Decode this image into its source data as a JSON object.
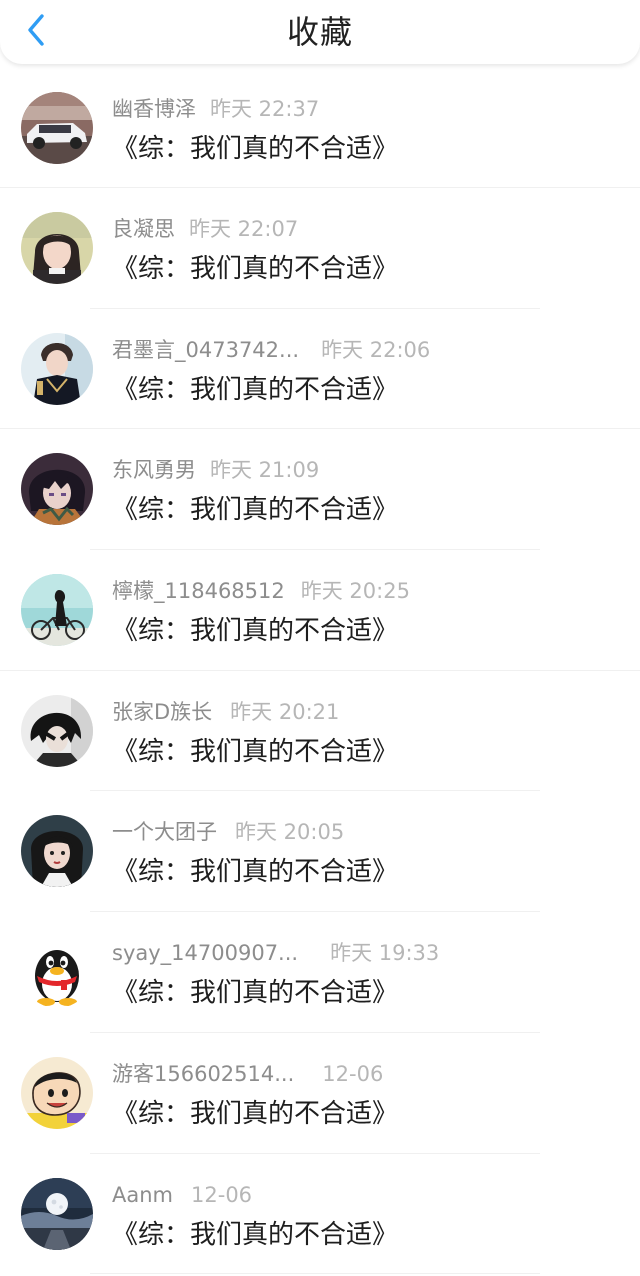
{
  "header": {
    "title": "收藏",
    "back_icon": "chevron-left-icon",
    "accent": "#2f9df4"
  },
  "items": [
    {
      "user": "幽香博泽",
      "time": "昨天 22:37",
      "book": "《综：我们真的不合适》",
      "avatar": "car-photo"
    },
    {
      "user": "良凝思",
      "time": "昨天 22:07",
      "book": "《综：我们真的不合适》",
      "avatar": "girl-photo"
    },
    {
      "user": "君墨言_0473742...",
      "time": "昨天 22:06",
      "book": "《综：我们真的不合适》",
      "avatar": "uniform-portrait"
    },
    {
      "user": "东风勇男",
      "time": "昨天 21:09",
      "book": "《综：我们真的不合适》",
      "avatar": "anime-boy"
    },
    {
      "user": "檸檬_118468512",
      "time": "昨天 20:25",
      "book": "《综：我们真的不合适》",
      "avatar": "bicycle-girl"
    },
    {
      "user": "张家D族长",
      "time": "昨天 20:21",
      "book": "《综：我们真的不合适》",
      "avatar": "dark-hair-boy"
    },
    {
      "user": "一个大团子",
      "time": "昨天 20:05",
      "book": "《综：我们真的不合适》",
      "avatar": "illustrated-woman"
    },
    {
      "user": "syay_14700907...",
      "time": "昨天 19:33",
      "book": "《综：我们真的不合适》",
      "avatar": "qq-penguin"
    },
    {
      "user": "游客156602514...",
      "time": "12-06",
      "book": "《综：我们真的不合适》",
      "avatar": "crayon-kid"
    },
    {
      "user": "Aanm",
      "time": "12-06",
      "book": "《综：我们真的不合适》",
      "avatar": "moon-night"
    }
  ]
}
